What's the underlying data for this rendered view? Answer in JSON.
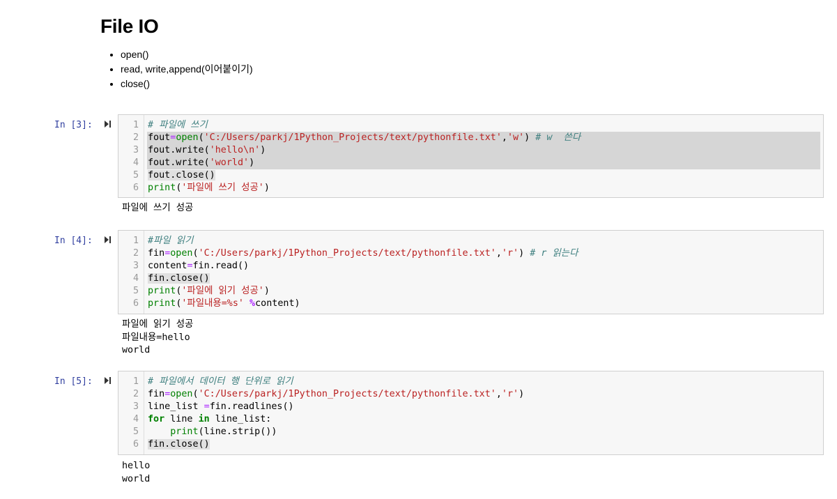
{
  "markdown": {
    "title": "File IO",
    "bullets": [
      "open()",
      "read, write,append(이어붙이기)",
      "close()"
    ]
  },
  "cells": [
    {
      "prompt": "In [3]:",
      "lines": [
        {
          "num": "1",
          "tokens": [
            {
              "t": "# 파일에 쓰기",
              "c": "cm"
            }
          ]
        },
        {
          "num": "2",
          "tokens": [
            {
              "t": "fout",
              "c": "txt"
            },
            {
              "t": "=",
              "c": "op"
            },
            {
              "t": "open",
              "c": "bi"
            },
            {
              "t": "(",
              "c": "txt"
            },
            {
              "t": "'C:/Users/parkj/1Python_Projects/text/pythonfile.txt'",
              "c": "str"
            },
            {
              "t": ",",
              "c": "txt"
            },
            {
              "t": "'w'",
              "c": "str"
            },
            {
              "t": ") ",
              "c": "txt"
            },
            {
              "t": "# w  쓴다",
              "c": "cm"
            }
          ]
        },
        {
          "num": "3",
          "tokens": [
            {
              "t": "fout.write(",
              "c": "txt"
            },
            {
              "t": "'hello\\n'",
              "c": "str"
            },
            {
              "t": ")",
              "c": "txt"
            }
          ]
        },
        {
          "num": "4",
          "tokens": [
            {
              "t": "fout.write(",
              "c": "txt"
            },
            {
              "t": "'world'",
              "c": "str"
            },
            {
              "t": ")",
              "c": "txt"
            }
          ]
        },
        {
          "num": "5",
          "tokens": [
            {
              "t": "fout.close()",
              "c": "txt"
            }
          ]
        },
        {
          "num": "6",
          "tokens": [
            {
              "t": "print",
              "c": "bi"
            },
            {
              "t": "(",
              "c": "txt"
            },
            {
              "t": "'파일에 쓰기 성공'",
              "c": "str"
            },
            {
              "t": ")",
              "c": "txt"
            }
          ]
        }
      ],
      "output": "파일에 쓰기 성공"
    },
    {
      "prompt": "In [4]:",
      "lines": [
        {
          "num": "1",
          "tokens": [
            {
              "t": "#파일 읽기",
              "c": "cm"
            }
          ]
        },
        {
          "num": "2",
          "tokens": [
            {
              "t": "fin",
              "c": "txt"
            },
            {
              "t": "=",
              "c": "op"
            },
            {
              "t": "open",
              "c": "bi"
            },
            {
              "t": "(",
              "c": "txt"
            },
            {
              "t": "'C:/Users/parkj/1Python_Projects/text/pythonfile.txt'",
              "c": "str"
            },
            {
              "t": ",",
              "c": "txt"
            },
            {
              "t": "'r'",
              "c": "str"
            },
            {
              "t": ") ",
              "c": "txt"
            },
            {
              "t": "# r 읽는다",
              "c": "cm"
            }
          ]
        },
        {
          "num": "3",
          "tokens": [
            {
              "t": "content",
              "c": "txt"
            },
            {
              "t": "=",
              "c": "op"
            },
            {
              "t": "fin.read()",
              "c": "txt"
            }
          ]
        },
        {
          "num": "4",
          "tokens": [
            {
              "t": "fin.close()",
              "c": "txt"
            }
          ]
        },
        {
          "num": "5",
          "tokens": [
            {
              "t": "print",
              "c": "bi"
            },
            {
              "t": "(",
              "c": "txt"
            },
            {
              "t": "'파일에 읽기 성공'",
              "c": "str"
            },
            {
              "t": ")",
              "c": "txt"
            }
          ]
        },
        {
          "num": "6",
          "tokens": [
            {
              "t": "print",
              "c": "bi"
            },
            {
              "t": "(",
              "c": "txt"
            },
            {
              "t": "'파일내용=%s'",
              "c": "str"
            },
            {
              "t": " ",
              "c": "txt"
            },
            {
              "t": "%",
              "c": "opb"
            },
            {
              "t": "content)",
              "c": "txt"
            }
          ]
        }
      ],
      "output": "파일에 읽기 성공\n파일내용=hello\nworld"
    },
    {
      "prompt": "In [5]:",
      "lines": [
        {
          "num": "1",
          "tokens": [
            {
              "t": "# 파일에서 데이터 행 단위로 읽기",
              "c": "cm"
            }
          ]
        },
        {
          "num": "2",
          "tokens": [
            {
              "t": "fin",
              "c": "txt"
            },
            {
              "t": "=",
              "c": "op"
            },
            {
              "t": "open",
              "c": "bi"
            },
            {
              "t": "(",
              "c": "txt"
            },
            {
              "t": "'C:/Users/parkj/1Python_Projects/text/pythonfile.txt'",
              "c": "str"
            },
            {
              "t": ",",
              "c": "txt"
            },
            {
              "t": "'r'",
              "c": "str"
            },
            {
              "t": ")",
              "c": "txt"
            }
          ]
        },
        {
          "num": "3",
          "tokens": [
            {
              "t": "line_list ",
              "c": "txt"
            },
            {
              "t": "=",
              "c": "op"
            },
            {
              "t": "fin.readlines()",
              "c": "txt"
            }
          ]
        },
        {
          "num": "4",
          "tokens": [
            {
              "t": "for",
              "c": "kw"
            },
            {
              "t": " line ",
              "c": "txt"
            },
            {
              "t": "in",
              "c": "kw"
            },
            {
              "t": " line_list:",
              "c": "txt"
            }
          ]
        },
        {
          "num": "5",
          "tokens": [
            {
              "t": "    ",
              "c": "txt"
            },
            {
              "t": "print",
              "c": "bi"
            },
            {
              "t": "(line.strip())",
              "c": "txt"
            }
          ]
        },
        {
          "num": "6",
          "tokens": [
            {
              "t": "fin.close()",
              "c": "txt"
            }
          ]
        }
      ],
      "output": "hello\nworld"
    }
  ]
}
